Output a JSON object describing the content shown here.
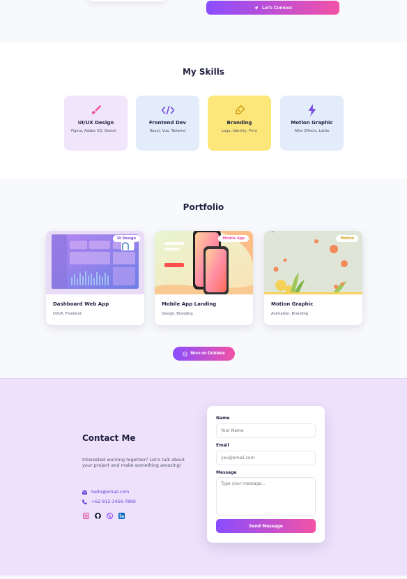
{
  "top": {
    "connect_label": "Let's Connect"
  },
  "skills": {
    "title": "My Skills",
    "items": [
      {
        "name": "UI/UX Design",
        "desc": "Figma, Adobe XD, Sketch",
        "icon": "paintbrush-icon",
        "bg": "#f0e6fb",
        "color": "#f0569c"
      },
      {
        "name": "Frontend Dev",
        "desc": "React, Vue, Tailwind",
        "icon": "code-icon",
        "bg": "#e3ecfb",
        "color": "#7b4de0"
      },
      {
        "name": "Branding",
        "desc": "Logo, Identity, Print",
        "icon": "pen-nib-icon",
        "bg": "#fde67a",
        "color": "#d8a114"
      },
      {
        "name": "Motion Graphic",
        "desc": "After Effects, Lottie",
        "icon": "lightning-icon",
        "bg": "#e3ecfb",
        "color": "#7b4de0"
      }
    ]
  },
  "portfolio": {
    "title": "Portfolio",
    "items": [
      {
        "title": "Dashboard Web App",
        "sub": "UI/UX, Frontend",
        "tag": "UI Design",
        "tag_color": "#7b4de0"
      },
      {
        "title": "Mobile App Landing",
        "sub": "Design, Branding",
        "tag": "Mobile App",
        "tag_color": "#f0569c"
      },
      {
        "title": "Motion Graphic",
        "sub": "Animation, Branding",
        "tag": "Motion",
        "tag_color": "#d8a114"
      }
    ],
    "more_label": "More on Dribbble"
  },
  "contact": {
    "title": "Contact Me",
    "text": "Interested working together? Let's talk about your project and make something amazing!",
    "email": "hello@email.com",
    "phone": "+62 812-3456-7890",
    "socials": [
      "instagram-icon",
      "github-icon",
      "dribbble-icon",
      "linkedin-icon"
    ],
    "form": {
      "name_label": "Name",
      "name_placeholder": "Your Name",
      "email_label": "Email",
      "email_placeholder": "you@email.com",
      "message_label": "Message",
      "message_placeholder": "Type your message...",
      "send_label": "Send Message"
    }
  }
}
